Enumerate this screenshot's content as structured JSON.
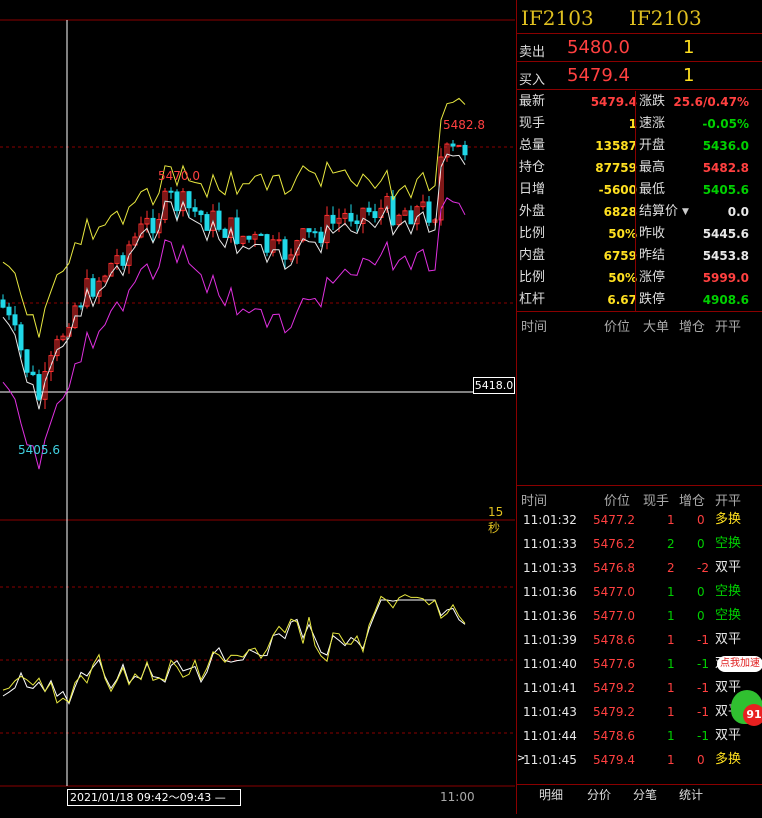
{
  "symbol_left": "IF2103",
  "symbol_right": "IF2103",
  "sell_label": "卖出",
  "sell_price": "5480.0",
  "sell_vol": "1",
  "buy_label": "买入",
  "buy_price": "5479.4",
  "buy_vol": "1",
  "stats": [
    {
      "l1": "最新",
      "v1": "5479.4",
      "c1": "red",
      "l2": "涨跌",
      "v2": "25.6/0.47%",
      "c2": "red"
    },
    {
      "l1": "现手",
      "v1": "1",
      "c1": "yel",
      "l2": "速涨",
      "v2": "-0.05%",
      "c2": "grn"
    },
    {
      "l1": "总量",
      "v1": "13587",
      "c1": "yel",
      "l2": "开盘",
      "v2": "5436.0",
      "c2": "grn"
    },
    {
      "l1": "持仓",
      "v1": "87759",
      "c1": "yel",
      "l2": "最高",
      "v2": "5482.8",
      "c2": "red"
    },
    {
      "l1": "日增",
      "v1": "-5600",
      "c1": "yel",
      "l2": "最低",
      "v2": "5405.6",
      "c2": "grn"
    },
    {
      "l1": "外盘",
      "v1": "6828",
      "c1": "yel",
      "l2": "结算价",
      "v2": "0.0",
      "c2": "wht"
    },
    {
      "l1": "比例",
      "v1": "50%",
      "c1": "yel",
      "l2": "昨收",
      "v2": "5445.6",
      "c2": "wht"
    },
    {
      "l1": "内盘",
      "v1": "6759",
      "c1": "yel",
      "l2": "昨结",
      "v2": "5453.8",
      "c2": "wht"
    },
    {
      "l1": "比例",
      "v1": "50%",
      "c1": "yel",
      "l2": "涨停",
      "v2": "5999.0",
      "c2": "red"
    },
    {
      "l1": "杠杆",
      "v1": "6.67",
      "c1": "yel",
      "l2": "跌停",
      "v2": "4908.6",
      "c2": "grn"
    }
  ],
  "bigorder_header": {
    "time": "时间",
    "price": "价位",
    "big": "大单",
    "inc": "增仓",
    "oc": "开平"
  },
  "tick_header": {
    "time": "时间",
    "price": "价位",
    "hand": "现手",
    "inc": "增仓",
    "oc": "开平"
  },
  "ticks": [
    {
      "time": "11:01:32",
      "price": "5477.2",
      "hand": "1",
      "hc": "red",
      "inc": "0",
      "oc": "多换",
      "occ": "yel"
    },
    {
      "time": "11:01:33",
      "price": "5476.2",
      "hand": "2",
      "hc": "grn",
      "inc": "0",
      "oc": "空换",
      "occ": "grn"
    },
    {
      "time": "11:01:33",
      "price": "5476.8",
      "hand": "2",
      "hc": "red",
      "inc": "-2",
      "oc": "双平",
      "occ": "wht"
    },
    {
      "time": "11:01:36",
      "price": "5477.0",
      "hand": "1",
      "hc": "grn",
      "inc": "0",
      "oc": "空换",
      "occ": "grn"
    },
    {
      "time": "11:01:36",
      "price": "5477.0",
      "hand": "1",
      "hc": "grn",
      "inc": "0",
      "oc": "空换",
      "occ": "grn"
    },
    {
      "time": "11:01:39",
      "price": "5478.6",
      "hand": "1",
      "hc": "red",
      "inc": "-1",
      "oc": "双平",
      "occ": "wht"
    },
    {
      "time": "11:01:40",
      "price": "5477.6",
      "hand": "1",
      "hc": "grn",
      "inc": "-1",
      "oc": "双平",
      "occ": "wht"
    },
    {
      "time": "11:01:41",
      "price": "5479.2",
      "hand": "1",
      "hc": "red",
      "inc": "-1",
      "oc": "双平",
      "occ": "wht"
    },
    {
      "time": "11:01:43",
      "price": "5479.2",
      "hand": "1",
      "hc": "red",
      "inc": "-1",
      "oc": "双平",
      "occ": "wht"
    },
    {
      "time": "11:01:44",
      "price": "5478.6",
      "hand": "1",
      "hc": "grn",
      "inc": "-1",
      "oc": "双平",
      "occ": "wht"
    },
    {
      "time": "11:01:45",
      "price": "5479.4",
      "hand": "1",
      "hc": "red",
      "inc": "0",
      "oc": "多换",
      "occ": "yel"
    }
  ],
  "tabs": [
    "明细",
    "分价",
    "分笔",
    "统计"
  ],
  "promo_badge": "点我加速",
  "promo_number": "91",
  "chart": {
    "high_label": "5482.8",
    "mid_label": "5470.0",
    "low_label": "5405.6",
    "crosshair_price": "5418.0",
    "period_label": "15秒",
    "crosshair_time": "2021/01/18 09:42～09:43 —",
    "axis_time": "11:00"
  },
  "colors": {
    "up": "#ff3030",
    "down": "#20d8e8",
    "upper_band": "#e8e840",
    "mid_band": "#e8e8e8",
    "lower_band": "#e030e0",
    "grid": "#8a0000"
  }
}
